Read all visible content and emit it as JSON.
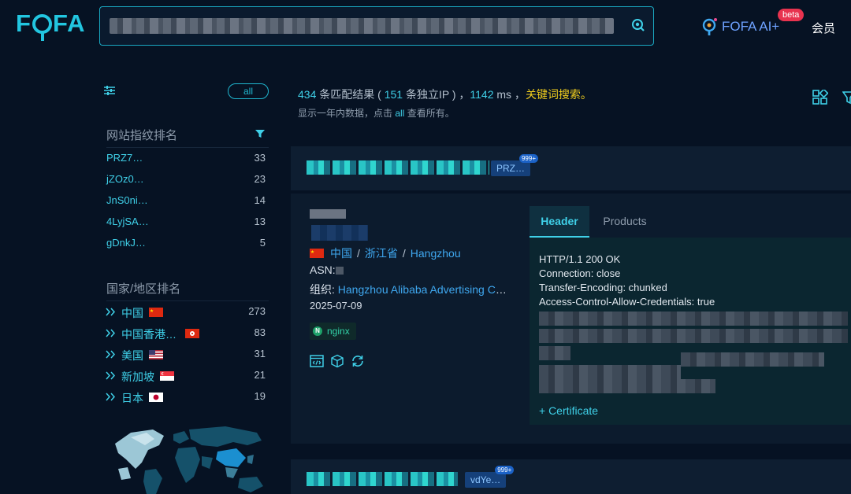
{
  "header": {
    "logo": "FOFA",
    "ai_label": "FOFA AI+",
    "beta_badge": "beta",
    "member_label": "会员"
  },
  "sidebar": {
    "all_pill": "all",
    "fingerprint_heading": "网站指纹排名",
    "fingerprints": [
      {
        "name": "PRZ7…",
        "count": "33"
      },
      {
        "name": "jZOz0…",
        "count": "23"
      },
      {
        "name": "JnS0ni…",
        "count": "14"
      },
      {
        "name": "4LyjSA…",
        "count": "13"
      },
      {
        "name": "gDnkJ…",
        "count": "5"
      }
    ],
    "country_heading": "国家/地区排名",
    "countries": [
      {
        "name": "中国",
        "count": "273",
        "flag": "cn-flag-icon"
      },
      {
        "name": "中国香港…",
        "count": "83",
        "flag": "hk-flag-icon"
      },
      {
        "name": "美国",
        "count": "31",
        "flag": "us-flag-icon"
      },
      {
        "name": "新加坡",
        "count": "21",
        "flag": "sg-flag-icon"
      },
      {
        "name": "日本",
        "count": "19",
        "flag": "jp-flag-icon"
      }
    ]
  },
  "summary": {
    "count": "434",
    "text1": " 条匹配结果 ( ",
    "ips": "151",
    "text2": " 条独立IP ) ，",
    "ms": "1142",
    "text3": " ms ，",
    "keyword": "关键词搜索。",
    "sub1": "显示一年内数据，点击 ",
    "sub_link": "all",
    "sub2": " 查看所有。"
  },
  "results": {
    "first_tag": "PRZ…",
    "first_badge": "999+",
    "second_tag": "vdYe…",
    "second_badge": "999+",
    "detail": {
      "country": "中国",
      "province": "浙江省",
      "city": "Hangzhou",
      "sep": "/",
      "asn_label": "ASN:",
      "org_label": "组织: ",
      "org_value": "Hangzhou Alibaba Advertising Co.,Ltd.",
      "date": "2025-07-09",
      "server_tag": "nginx",
      "tabs": {
        "header": "Header",
        "products": "Products"
      },
      "http_lines": [
        "HTTP/1.1 200 OK",
        "Connection: close",
        "Transfer-Encoding: chunked",
        "Access-Control-Allow-Credentials: true"
      ],
      "certificate": "+ Certificate"
    }
  },
  "colors": {
    "accent": "#3fd0e8",
    "keyword": "#f2cf1e",
    "background": "#061223"
  }
}
